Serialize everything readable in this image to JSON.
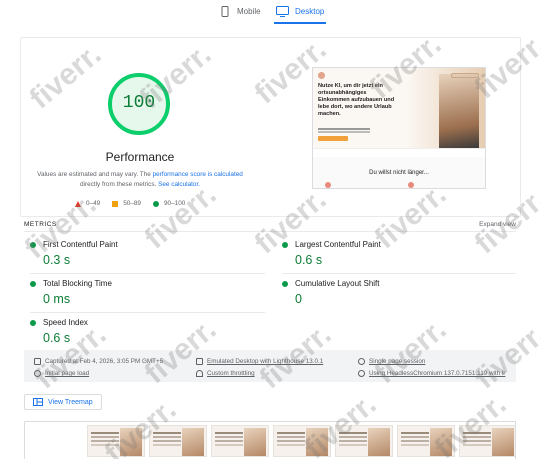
{
  "tabs": [
    {
      "label": "Mobile",
      "icon": "smartphone-icon",
      "active": false
    },
    {
      "label": "Desktop",
      "icon": "monitor-icon",
      "active": true
    }
  ],
  "score": {
    "value": "100",
    "fraction": 1.0,
    "label": "Performance",
    "color": "#0cce6b"
  },
  "description": {
    "text1": "Values are estimated and may vary. The ",
    "link1": "performance score is calculated",
    "text2": "directly from these metrics. ",
    "link2": "See calculator."
  },
  "legend": [
    {
      "range": "0–49",
      "shape": "triangle",
      "color": "#e8331c"
    },
    {
      "range": "50–89",
      "shape": "square",
      "color": "#f0a20e"
    },
    {
      "range": "90–100",
      "shape": "circle",
      "color": "#0c9a4a"
    }
  ],
  "preview": {
    "headline": "Nutze KI, um dir jetzt ein ortsunabhängiges Einkommen aufzubauen und lebe dort, wo andere Urlaub machen.",
    "subheading": "Du willst nicht länger..."
  },
  "metrics_header": {
    "title": "METRICS",
    "expand": "Expand view"
  },
  "metrics": [
    {
      "label": "First Contentful Paint",
      "value": "0.3 s"
    },
    {
      "label": "Largest Contentful Paint",
      "value": "0.6 s"
    },
    {
      "label": "Total Blocking Time",
      "value": "0 ms"
    },
    {
      "label": "Cumulative Layout Shift",
      "value": "0"
    },
    {
      "label": "Speed Index",
      "value": "0.6 s"
    }
  ],
  "info": {
    "captured": "Captured at Feb 4, 2026, 3:05 PM GMT+5",
    "emulated": "Emulated Desktop with Lighthouse 13.0.1",
    "session": "Single page session",
    "initial": "Initial page load",
    "throttling": "Custom throttling",
    "browser": "Using HeadlessChromium 137.0.7151.119 with lr"
  },
  "treemap_button": "View Treemap",
  "watermark": "fiverr."
}
